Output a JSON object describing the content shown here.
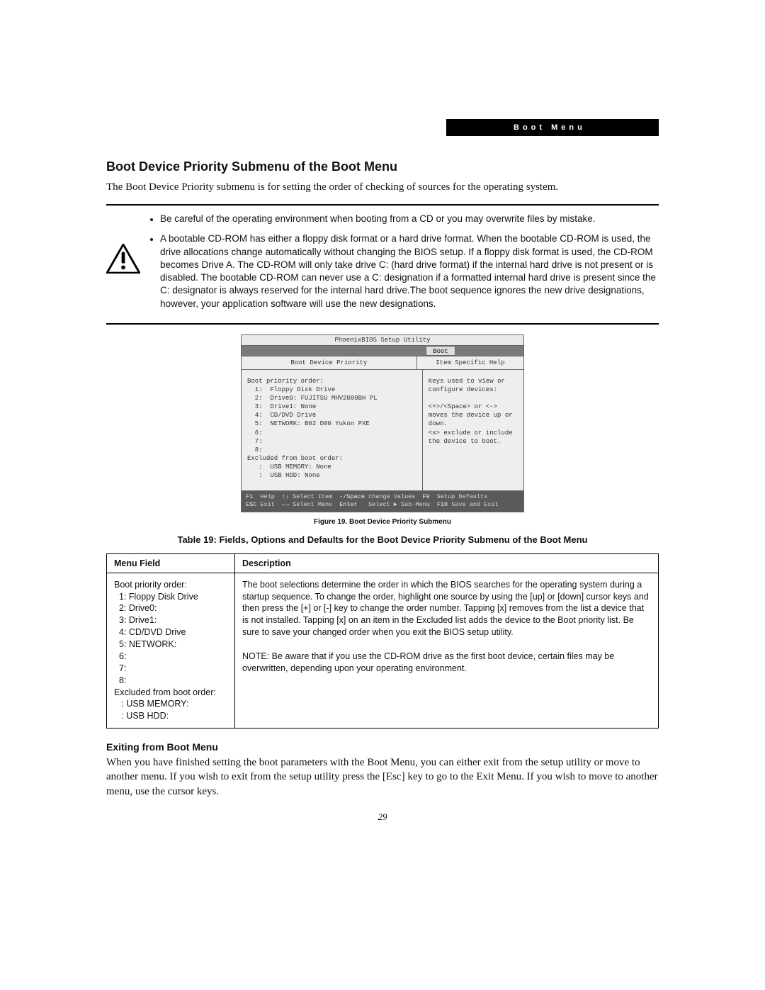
{
  "header_tab": "Boot Menu",
  "section_heading": "Boot Device Priority Submenu of the Boot Menu",
  "intro": "The Boot Device Priority submenu is for setting the order of checking of sources for the operating system.",
  "caution_items": [
    "Be careful of the operating environment when booting from a CD or you may overwrite files by mistake.",
    "A bootable CD-ROM has either a floppy disk format or a hard drive format. When the bootable CD-ROM is used, the drive allocations change automatically without changing the BIOS setup. If a floppy disk format is used, the CD-ROM becomes Drive A. The CD-ROM will only take drive C: (hard drive format) if the internal hard drive is not present or is disabled. The bootable CD-ROM can never use a C: designation if a formatted internal hard drive is present since the C: designator is always reserved for the internal hard drive.The boot sequence ignores the new drive designations, however, your application software will use the new designations."
  ],
  "bios": {
    "title": "PhoenixBIOS Setup Utility",
    "active_tab": "Boot",
    "left_header": "Boot Device Priority",
    "right_header": "Item Specific Help",
    "left_body": "Boot priority order:\n  1:  Floppy Disk Drive\n  2:  Drive0: FUJITSU MHV2080BH PL\n  3:  Drive1: None\n  4:  CD/DVD Drive\n  5:  NETWORK: B02 D00 Yukon PXE\n  6:\n  7:\n  8:\nExcluded from boot order:\n   :  USB MEMORY: None\n   :  USB HDD: None",
    "right_body": "Keys used to view or\nconfigure devices:\n\n<+>/<Space> or <->\nmoves the device up or\ndown.\n<x> exclude or include\nthe device to boot.",
    "footer_row1": {
      "k1": "F1",
      "l1": "Help",
      "k2": "↑↓",
      "l2": "Select Item",
      "k3": "-/Space",
      "l3": "Change Values",
      "k4": "F9",
      "l4": "Setup Defaults"
    },
    "footer_row2": {
      "k1": "ESC",
      "l1": "Exit",
      "k2": "←→",
      "l2": "Select Menu",
      "k3": "Enter",
      "l3": "Select ▶ Sub-Menu",
      "k4": "F10",
      "l4": "Save and Exit"
    }
  },
  "figure_caption": "Figure 19.  Boot Device Priority Submenu",
  "table_caption": "Table 19: Fields, Options and Defaults for the Boot Device Priority Submenu of the Boot Menu",
  "table": {
    "headers": {
      "col1": "Menu Field",
      "col2": "Description"
    },
    "menu_field": "Boot priority order:\n  1: Floppy Disk Drive\n  2: Drive0:\n  3: Drive1:\n  4: CD/DVD Drive\n  5: NETWORK:\n  6:\n  7:\n  8:\nExcluded from boot order:\n   : USB MEMORY:\n   : USB HDD:",
    "description_p1": "The boot selections determine the order in which the BIOS searches for the operating system during a startup sequence. To change the order, highlight one source by using the [up] or [down] cursor keys and then press the [+] or [-] key to change the order number. Tapping [x] removes from the list a device that is not installed. Tapping [x] on an item in the Excluded list adds the device to the Boot priority list. Be sure to save your changed order when you exit the BIOS setup utility.",
    "description_p2": "NOTE: Be aware that if you use the CD-ROM drive as the first boot device, certain files may be overwritten, depending upon your operating environment."
  },
  "exit_heading": "Exiting from Boot Menu",
  "exit_body": "When you have finished setting the boot parameters with the Boot Menu, you can either exit from the setup utility or move to another menu. If you wish to exit from the setup utility press the [Esc] key to go to the Exit Menu. If you wish to move to another menu, use the cursor keys.",
  "page_number": "29"
}
